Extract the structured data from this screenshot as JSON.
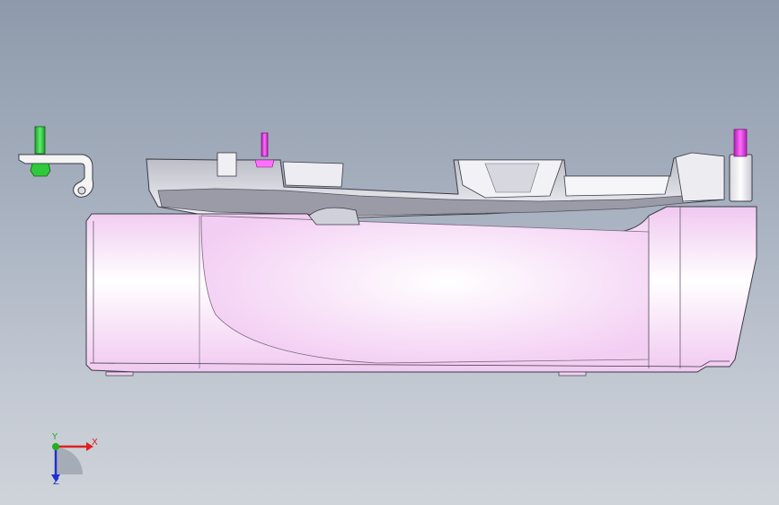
{
  "viewport": {
    "background_top": "#8e9aab",
    "background_bottom": "#cfd3da"
  },
  "model": {
    "body_color": "#f3d2f3",
    "body_highlight": "#ffffff",
    "edge_color": "#3a3a44",
    "tray_color": "#e8e8ee",
    "tray_shadow": "#8a8a96",
    "bracket_color": "#f2f2f2",
    "pin_green": "#2ec43a",
    "pin_magenta": "#d83ad8"
  },
  "triad": {
    "x_label": "X",
    "y_label": "Y",
    "z_label": "Z",
    "x_color": "#e02020",
    "y_color": "#20b020",
    "z_color": "#2030d0"
  }
}
